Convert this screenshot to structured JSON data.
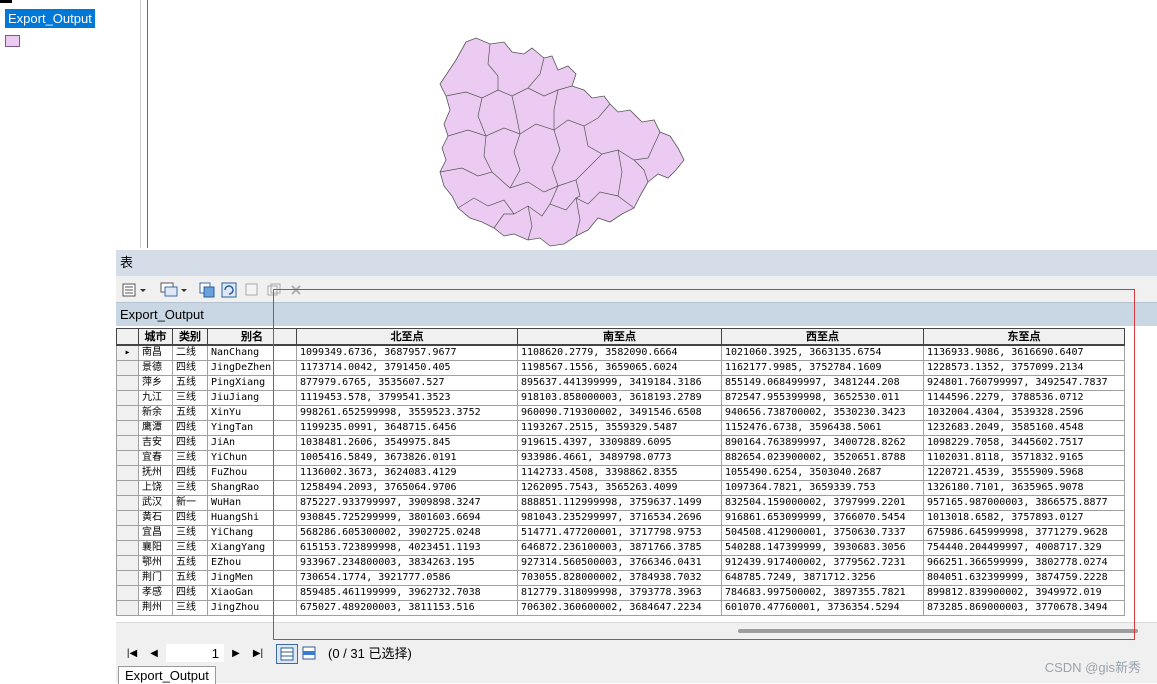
{
  "toc": {
    "layer_name": "Export_Output",
    "fill_color": "#eccbf2"
  },
  "table_window": {
    "title": "表",
    "tab_name": "Export_Output"
  },
  "columns": [
    "城市",
    "类别",
    "别名",
    "北至点",
    "南至点",
    "西至点",
    "东至点"
  ],
  "rows": [
    [
      "南昌",
      "二线",
      "NanChang",
      "1099349.6736, 3687957.9677",
      "1108620.2779, 3582090.6664",
      "1021060.3925, 3663135.6754",
      "1136933.9086, 3616690.6407"
    ],
    [
      "景德",
      "四线",
      "JingDeZhen",
      "1173714.0042, 3791450.405",
      "1198567.1556, 3659065.6024",
      "1162177.9985, 3752784.1609",
      "1228573.1352, 3757099.2134"
    ],
    [
      "萍乡",
      "五线",
      "PingXiang",
      "877979.6765, 3535607.527",
      "895637.441399999, 3419184.3186",
      "855149.068499997, 3481244.208",
      "924801.760799997, 3492547.7837"
    ],
    [
      "九江",
      "三线",
      "JiuJiang",
      "1119453.578, 3799541.3523",
      "918103.858000003, 3618193.2789",
      "872547.955399998, 3652530.011",
      "1144596.2279, 3788536.0712"
    ],
    [
      "新余",
      "五线",
      "XinYu",
      "998261.652599998, 3559523.3752",
      "960090.719300002, 3491546.6508",
      "940656.738700002, 3530230.3423",
      "1032004.4304, 3539328.2596"
    ],
    [
      "鹰潭",
      "四线",
      "YingTan",
      "1199235.0991, 3648715.6456",
      "1193267.2515, 3559329.5487",
      "1152476.6738, 3596438.5061",
      "1232683.2049, 3585160.4548"
    ],
    [
      "吉安",
      "四线",
      "JiAn",
      "1038481.2606, 3549975.845",
      "919615.4397, 3309889.6095",
      "890164.763899997, 3400728.8262",
      "1098229.7058, 3445602.7517"
    ],
    [
      "宜春",
      "三线",
      "YiChun",
      "1005416.5849, 3673826.0191",
      "933986.4661, 3489798.0773",
      "882654.023900002, 3520651.8788",
      "1102031.8118, 3571832.9165"
    ],
    [
      "抚州",
      "四线",
      "FuZhou",
      "1136002.3673, 3624083.4129",
      "1142733.4508, 3398862.8355",
      "1055490.6254, 3503040.2687",
      "1220721.4539, 3555909.5968"
    ],
    [
      "上饶",
      "三线",
      "ShangRao",
      "1258494.2093, 3765064.9706",
      "1262095.7543, 3565263.4099",
      "1097364.7821, 3659339.753",
      "1326180.7101, 3635965.9078"
    ],
    [
      "武汉",
      "新一",
      "WuHan",
      "875227.933799997, 3909898.3247",
      "888851.112999998, 3759637.1499",
      "832504.159000002, 3797999.2201",
      "957165.987000003, 3866575.8877"
    ],
    [
      "黄石",
      "四线",
      "HuangShi",
      "930845.725299999, 3801603.6694",
      "981043.235299997, 3716534.2696",
      "916861.653099999, 3766070.5454",
      "1013018.6582, 3757893.0127"
    ],
    [
      "宜昌",
      "三线",
      "YiChang",
      "568286.605300002, 3902725.0248",
      "514771.477200001, 3717798.9753",
      "504508.412900001, 3750630.7337",
      "675986.645999998, 3771279.9628"
    ],
    [
      "襄阳",
      "三线",
      "XiangYang",
      "615153.723899998, 4023451.1193",
      "646872.236100003, 3871766.3785",
      "540288.147399999, 3930683.3056",
      "754440.204499997, 4008717.329"
    ],
    [
      "鄂州",
      "五线",
      "EZhou",
      "933967.234800003, 3834263.195",
      "927314.560500003, 3766346.0431",
      "912439.917400002, 3779562.7231",
      "966251.366599999, 3802778.0274"
    ],
    [
      "荆门",
      "五线",
      "JingMen",
      "730654.1774, 3921777.0586",
      "703055.828000002, 3784938.7032",
      "648785.7249, 3871712.3256",
      "804051.632399999, 3874759.2228"
    ],
    [
      "孝感",
      "四线",
      "XiaoGan",
      "859485.461199999, 3962732.7038",
      "812779.318099998, 3793778.3963",
      "784683.997500002, 3897355.7821",
      "899812.839900002, 3949972.019"
    ],
    [
      "荆州",
      "三线",
      "JingZhou",
      "675027.489200003, 3811153.516",
      "706302.360600002, 3684647.2234",
      "601070.47760001, 3736354.5294",
      "873285.869000003, 3770678.3494"
    ]
  ],
  "nav": {
    "page": "1",
    "status": "(0 / 31 已选择)"
  },
  "bottom_tab": "Export_Output",
  "watermark": "CSDN @gis新秀"
}
